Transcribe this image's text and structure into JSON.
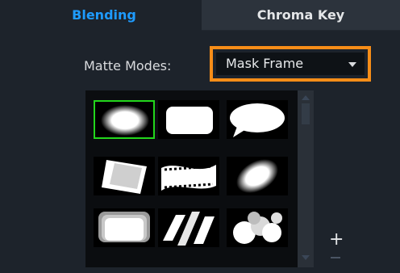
{
  "tabs": [
    {
      "label": "Blending",
      "active": true
    },
    {
      "label": "Chroma Key",
      "active": false
    }
  ],
  "matte": {
    "label": "Matte Modes:",
    "selected": "Mask Frame"
  },
  "controls": {
    "plus": "+",
    "minus": "−"
  },
  "colors": {
    "accent_tab": "#1e9bff",
    "highlight_border": "#f78d18",
    "selection": "#23d61c",
    "panel_bg": "#1d232b"
  },
  "masks": [
    {
      "icon": "oval-mask-icon",
      "selected": true
    },
    {
      "icon": "rounded-rectangle-mask-icon",
      "selected": false
    },
    {
      "icon": "speech-bubble-mask-icon",
      "selected": false
    },
    {
      "icon": "torn-paper-mask-icon",
      "selected": false
    },
    {
      "icon": "film-strip-mask-icon",
      "selected": false
    },
    {
      "icon": "tilted-oval-mask-icon",
      "selected": false
    },
    {
      "icon": "stacked-rectangles-mask-icon",
      "selected": false
    },
    {
      "icon": "slanted-stripes-mask-icon",
      "selected": false
    },
    {
      "icon": "circles-cluster-mask-icon",
      "selected": false
    }
  ]
}
